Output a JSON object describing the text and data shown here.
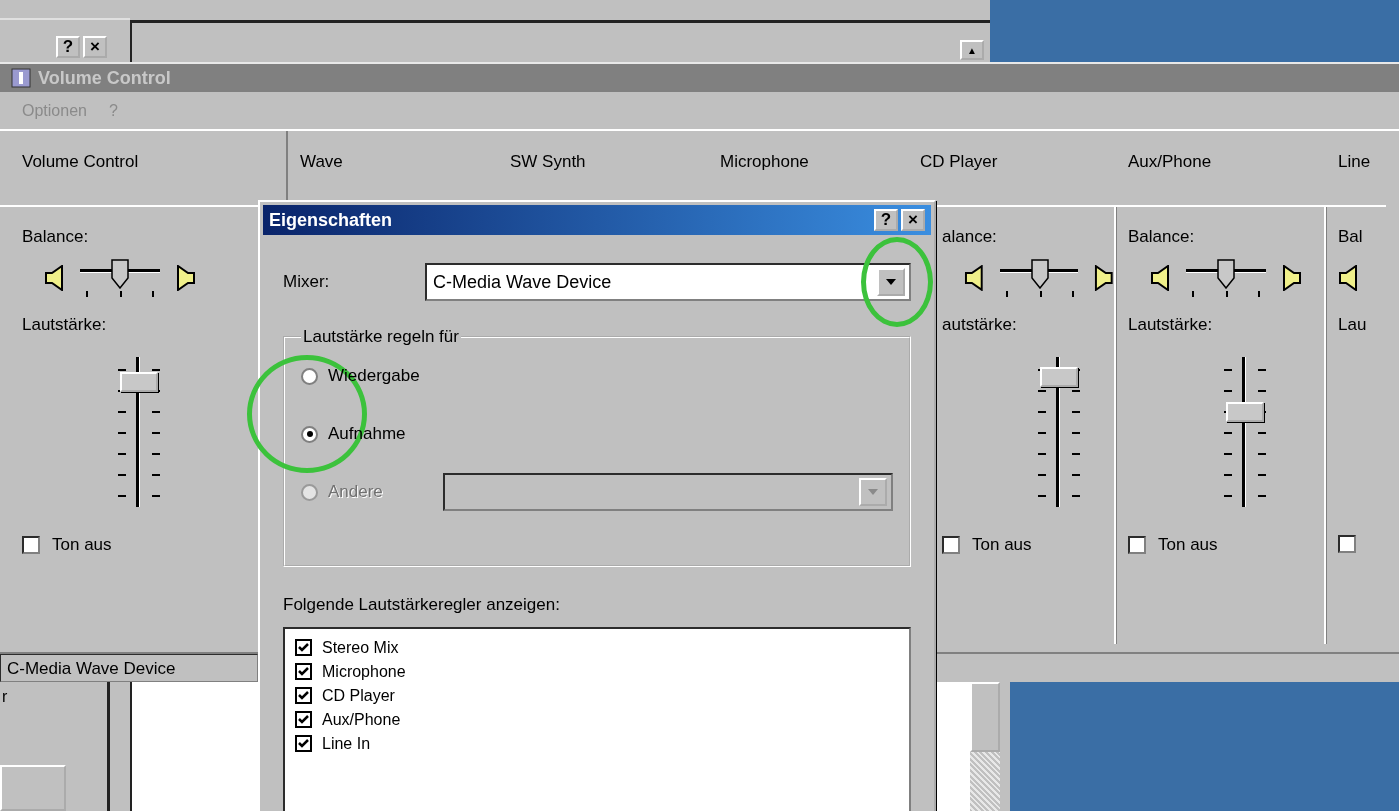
{
  "background_window": {
    "help_button": "?",
    "close_button": "×",
    "scroll_up": "▲",
    "side_text": "r"
  },
  "window": {
    "title": "Volume Control",
    "menu": [
      "Optionen",
      "?"
    ],
    "status_bar": "C-Media Wave Device"
  },
  "channels": [
    {
      "kind": "full",
      "name": "Volume Control",
      "balance_label": "Balance:",
      "balance": {
        "level": 0.5
      },
      "volume_label": "Lautstärke:",
      "volume": {
        "level": 0.88
      },
      "mute_label": "Ton aus",
      "muted": false
    },
    {
      "kind": "header_only",
      "name": "Wave"
    },
    {
      "kind": "header_only",
      "name": "SW Synth"
    },
    {
      "kind": "header_only",
      "name": "Microphone"
    },
    {
      "kind": "cut_left",
      "name": "CD Player",
      "balance_label": "alance:",
      "balance": {
        "level": 0.5
      },
      "volume_label": "autstärke:",
      "volume": {
        "level": 0.92
      },
      "mute_label": "Ton aus",
      "muted": false
    },
    {
      "kind": "full",
      "name": "Aux/Phone",
      "balance_label": "Balance:",
      "balance": {
        "level": 0.5
      },
      "volume_label": "Lautstärke:",
      "volume": {
        "level": 0.65
      },
      "mute_label": "Ton aus",
      "muted": false
    },
    {
      "kind": "cut_right",
      "name": "Line",
      "balance_label": "Bal",
      "volume_label": "Lau",
      "muted": false
    }
  ],
  "dialog": {
    "title": "Eigenschaften",
    "help_button": "?",
    "close_button": "×",
    "mixer_label": "Mixer:",
    "mixer_value": "C-Media Wave Device",
    "mixer_circled": true,
    "volume_for": {
      "legend": "Lautstärke regeln für",
      "circled": true,
      "options": [
        {
          "label": "Wiedergabe",
          "selected": false,
          "disabled": false
        },
        {
          "label": "Aufnahme",
          "selected": true,
          "disabled": false
        },
        {
          "label": "Andere",
          "selected": false,
          "disabled": true
        }
      ]
    },
    "controls_label": "Folgende Lautstärkeregler anzeigen:",
    "controls": [
      {
        "label": "Stereo Mix",
        "checked": true
      },
      {
        "label": "Microphone",
        "checked": true
      },
      {
        "label": "CD Player",
        "checked": true
      },
      {
        "label": "Aux/Phone",
        "checked": true
      },
      {
        "label": "Line In",
        "checked": true
      }
    ]
  }
}
